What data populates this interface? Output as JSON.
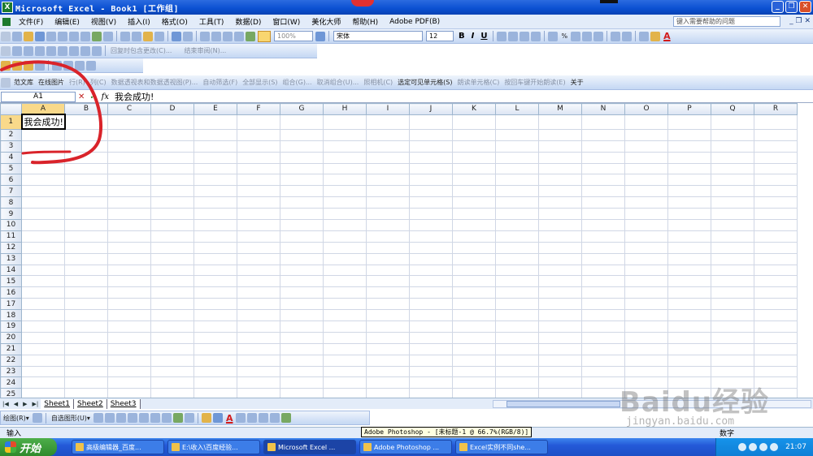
{
  "window": {
    "title": "Microsoft Excel - Book1  [工作组]",
    "app_icon": "X",
    "controls": [
      "_",
      "❐",
      "✕"
    ]
  },
  "menubar": {
    "items": [
      "文件(F)",
      "编辑(E)",
      "视图(V)",
      "插入(I)",
      "格式(O)",
      "工具(T)",
      "数据(D)",
      "窗口(W)",
      "美化大师",
      "帮助(H)",
      "Adobe PDF(B)"
    ],
    "help_placeholder": "键入需要帮助的问题",
    "mdi_controls": "_ ❐ ✕"
  },
  "toolbar_standard": {
    "zoom": "100%",
    "font_name": "宋体",
    "font_size": "12",
    "bold": "B",
    "italic": "I",
    "underline": "U",
    "percent": "%",
    "font_color_letter": "A"
  },
  "toolbar_review": {
    "reply_label": "回复时包含更改(C)...",
    "end_review_label": "结束审阅(N)..."
  },
  "toolbar_addin": {
    "items": [
      "范文库",
      "在线图片",
      "行(R)",
      "列(C)",
      "数据透视表和数据透视图(P)...",
      "自动筛选(F)",
      "全部显示(S)",
      "组合(G)...",
      "取消组合(U)...",
      "照相机(C)",
      "选定可见单元格(S)",
      "朗读单元格(C)",
      "按回车键开始朗读(E)",
      "关于"
    ]
  },
  "formula_bar": {
    "name_box": "A1",
    "cancel_symbol": "✕",
    "enter_symbol": "✓",
    "fx_symbol": "fx",
    "content": "我会成功!"
  },
  "grid": {
    "columns": [
      "A",
      "B",
      "C",
      "D",
      "E",
      "F",
      "G",
      "H",
      "I",
      "J",
      "K",
      "L",
      "M",
      "N",
      "O",
      "P",
      "Q",
      "R"
    ],
    "rows": [
      "1",
      "2",
      "3",
      "4",
      "5",
      "6",
      "7",
      "8",
      "9",
      "10",
      "11",
      "12",
      "13",
      "14",
      "15",
      "16",
      "17",
      "18",
      "19",
      "20",
      "21",
      "22",
      "23",
      "24",
      "25"
    ],
    "active_cell": "A1",
    "cells": {
      "A1": "我会成功!"
    },
    "annotation_color": "#d9232a"
  },
  "sheet_tabs": {
    "nav": [
      "|◀",
      "◀",
      "▶",
      "▶|"
    ],
    "tabs": [
      "Sheet1",
      "Sheet2",
      "Sheet3"
    ]
  },
  "drawing_toolbar": {
    "draw_label": "绘图(R)▾",
    "autoshapes_label": "自选图形(U)▾"
  },
  "status": {
    "text": "输入",
    "tooltip": "Adobe Photoshop - [未标题-1 @ 66.7%(RGB/8)]",
    "num": "数字"
  },
  "taskbar": {
    "start_label": "开始",
    "items": [
      "高级编辑器_百度...",
      "E:\\收入\\百度经验...",
      "Microsoft Excel ...",
      "Adobe Photoshop ...",
      "Excel实例不同she..."
    ],
    "active_index": 2,
    "clock": "21:07"
  },
  "watermark": {
    "main": "Baidu经验",
    "sub": "jingyan.baidu.com"
  }
}
